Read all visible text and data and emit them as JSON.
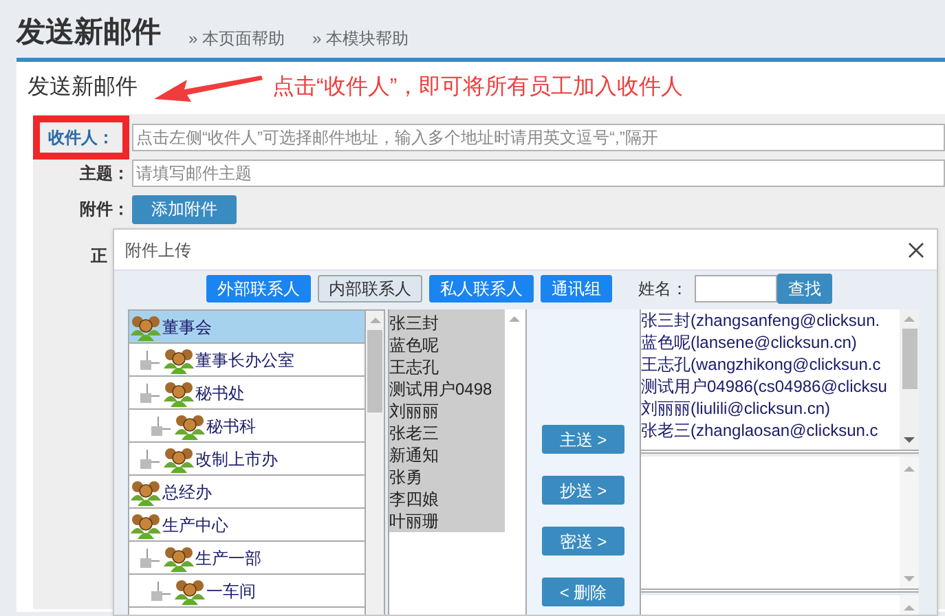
{
  "header": {
    "title": "发送新邮件",
    "links": [
      "» 本页面帮助",
      "» 本模块帮助"
    ]
  },
  "panel": {
    "title": "发送新邮件",
    "annotation": "点击“收件人”，即可将所有员工加入收件人"
  },
  "form": {
    "fields": [
      {
        "kind": "input",
        "label": "收件人：",
        "link": true,
        "highlighted": true,
        "placeholder": "点击左侧“收件人”可选择邮件地址，输入多个地址时请用英文逗号“,”隔开"
      },
      {
        "kind": "input",
        "label": "主题：",
        "link": false,
        "highlighted": false,
        "placeholder": "请填写邮件主题"
      },
      {
        "kind": "button",
        "label": "附件：",
        "link": false,
        "highlighted": false,
        "button": "添加附件"
      },
      {
        "kind": "editor",
        "label": "正",
        "link": false,
        "highlighted": false
      }
    ]
  },
  "dialog": {
    "title": "附件上传",
    "tabs": [
      {
        "label": "外部联系人",
        "selected": false
      },
      {
        "label": "内部联系人",
        "selected": true
      },
      {
        "label": "私人联系人",
        "selected": false
      },
      {
        "label": "通讯组",
        "selected": false
      }
    ],
    "search": {
      "label": "姓名：",
      "button": "查找"
    },
    "tree": [
      {
        "label": "董事会",
        "selected": true,
        "children": [
          {
            "label": "董事长办公室",
            "selected": false
          },
          {
            "label": "秘书处",
            "selected": false,
            "children": [
              {
                "label": "秘书科",
                "selected": false
              }
            ]
          },
          {
            "label": "改制上市办",
            "selected": false
          }
        ]
      },
      {
        "label": "总经办",
        "selected": false
      },
      {
        "label": "生产中心",
        "selected": false,
        "children": [
          {
            "label": "生产一部",
            "selected": false,
            "children": [
              {
                "label": "一车间",
                "selected": false
              }
            ]
          }
        ]
      }
    ],
    "names": [
      "张三封",
      "蓝色呢",
      "王志孔",
      "测试用户0498",
      "刘丽丽",
      "张老三",
      "新通知",
      "张勇",
      "李四娘",
      "叶丽珊"
    ],
    "actions": [
      "主送 >",
      "抄送 >",
      "密送 >",
      "< 删除"
    ],
    "recipients": [
      "张三封(zhangsanfeng@clicksun.",
      "蓝色呢(lansene@clicksun.cn)",
      "王志孔(wangzhikong@clicksun.c",
      "测试用户04986(cs04986@clicksu",
      "刘丽丽(liulili@clicksun.cn)",
      "张老三(zhanglaosan@clicksun.c"
    ]
  }
}
